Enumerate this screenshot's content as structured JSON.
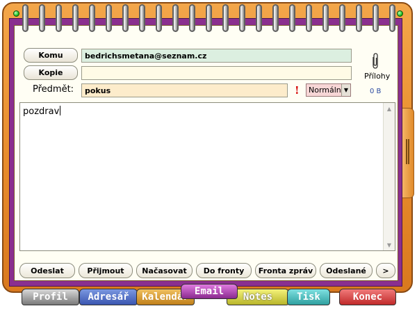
{
  "header": {
    "to_button": "Komu",
    "to_value": "bedrichsmetana@seznam.cz",
    "cc_button": "Kopie",
    "cc_value": "",
    "subject_label": "Předmět:",
    "subject_value": "pokus",
    "priority_value": "Normální",
    "attachments_label": "Přílohy",
    "attachments_size": "0 B"
  },
  "message": {
    "body": "pozdrav"
  },
  "actions": [
    "Odeslat",
    "Přijmout",
    "Načasovat",
    "Do fronty",
    "Fronta zpráv",
    "Odeslané",
    ">"
  ],
  "tabs": [
    "Profil",
    "Adresář",
    "Kalendář",
    "Email",
    "Notes",
    "Tisk",
    "Konec"
  ],
  "colors": {
    "frame": "#e98e2e",
    "page_border": "#8a2f8f",
    "to_field": "#dcefe0",
    "cc_field": "#fffbe6",
    "subject_field": "#fdeccb",
    "priority_field": "#f7d6d6",
    "excl_icon": "#d40000"
  }
}
